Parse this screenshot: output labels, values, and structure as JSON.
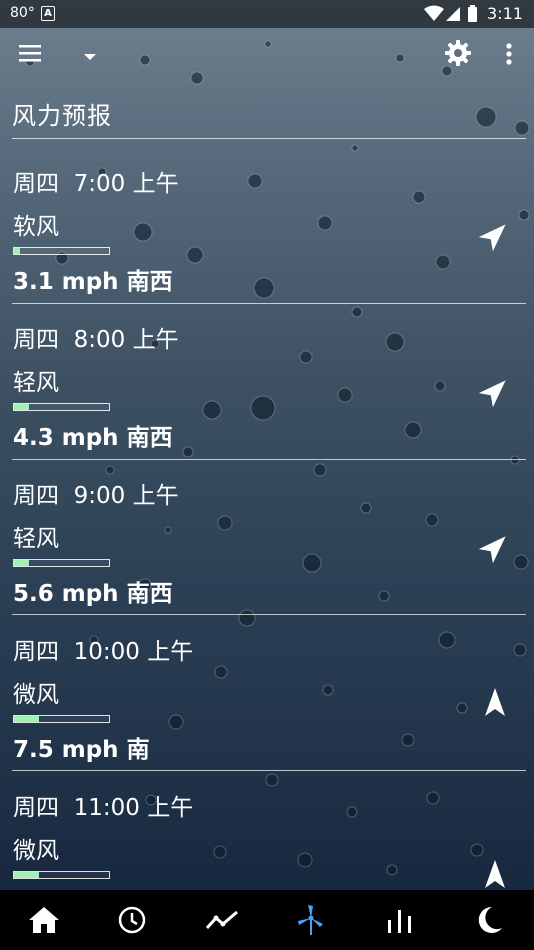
{
  "status_bar": {
    "temperature": "80°",
    "time": "3:11"
  },
  "toolbar": {
    "menu_icon": "hamburger-menu-icon",
    "dropdown_icon": "caret-down-icon",
    "settings_icon": "gear-icon",
    "overflow_icon": "more-vert-icon"
  },
  "section": {
    "title": "风力预报"
  },
  "forecast": [
    {
      "time": "周四  7:00 上午",
      "description": "软风",
      "speed": "3.1 mph 南西",
      "level": 0.06,
      "direction_deg": 45
    },
    {
      "time": "周四  8:00 上午",
      "description": "轻风",
      "speed": "4.3 mph 南西",
      "level": 0.16,
      "direction_deg": 45
    },
    {
      "time": "周四  9:00 上午",
      "description": "轻风",
      "speed": "5.6 mph 南西",
      "level": 0.16,
      "direction_deg": 45
    },
    {
      "time": "周四  10:00 上午",
      "description": "微风",
      "speed": "7.5 mph 南",
      "level": 0.26,
      "direction_deg": 0
    },
    {
      "time": "周四  11:00 上午",
      "description": "微风",
      "speed": "",
      "level": 0.26,
      "direction_deg": 0
    }
  ],
  "bottom_nav": {
    "items": [
      "home-icon",
      "clock-icon",
      "trend-chart-icon",
      "wind-turbine-icon",
      "bar-chart-icon",
      "moon-icon"
    ],
    "active_index": 3,
    "active_color": "#4aa3f0",
    "inactive_color": "#ffffff"
  },
  "colors": {
    "bar_fill": "#9ff2b4"
  }
}
